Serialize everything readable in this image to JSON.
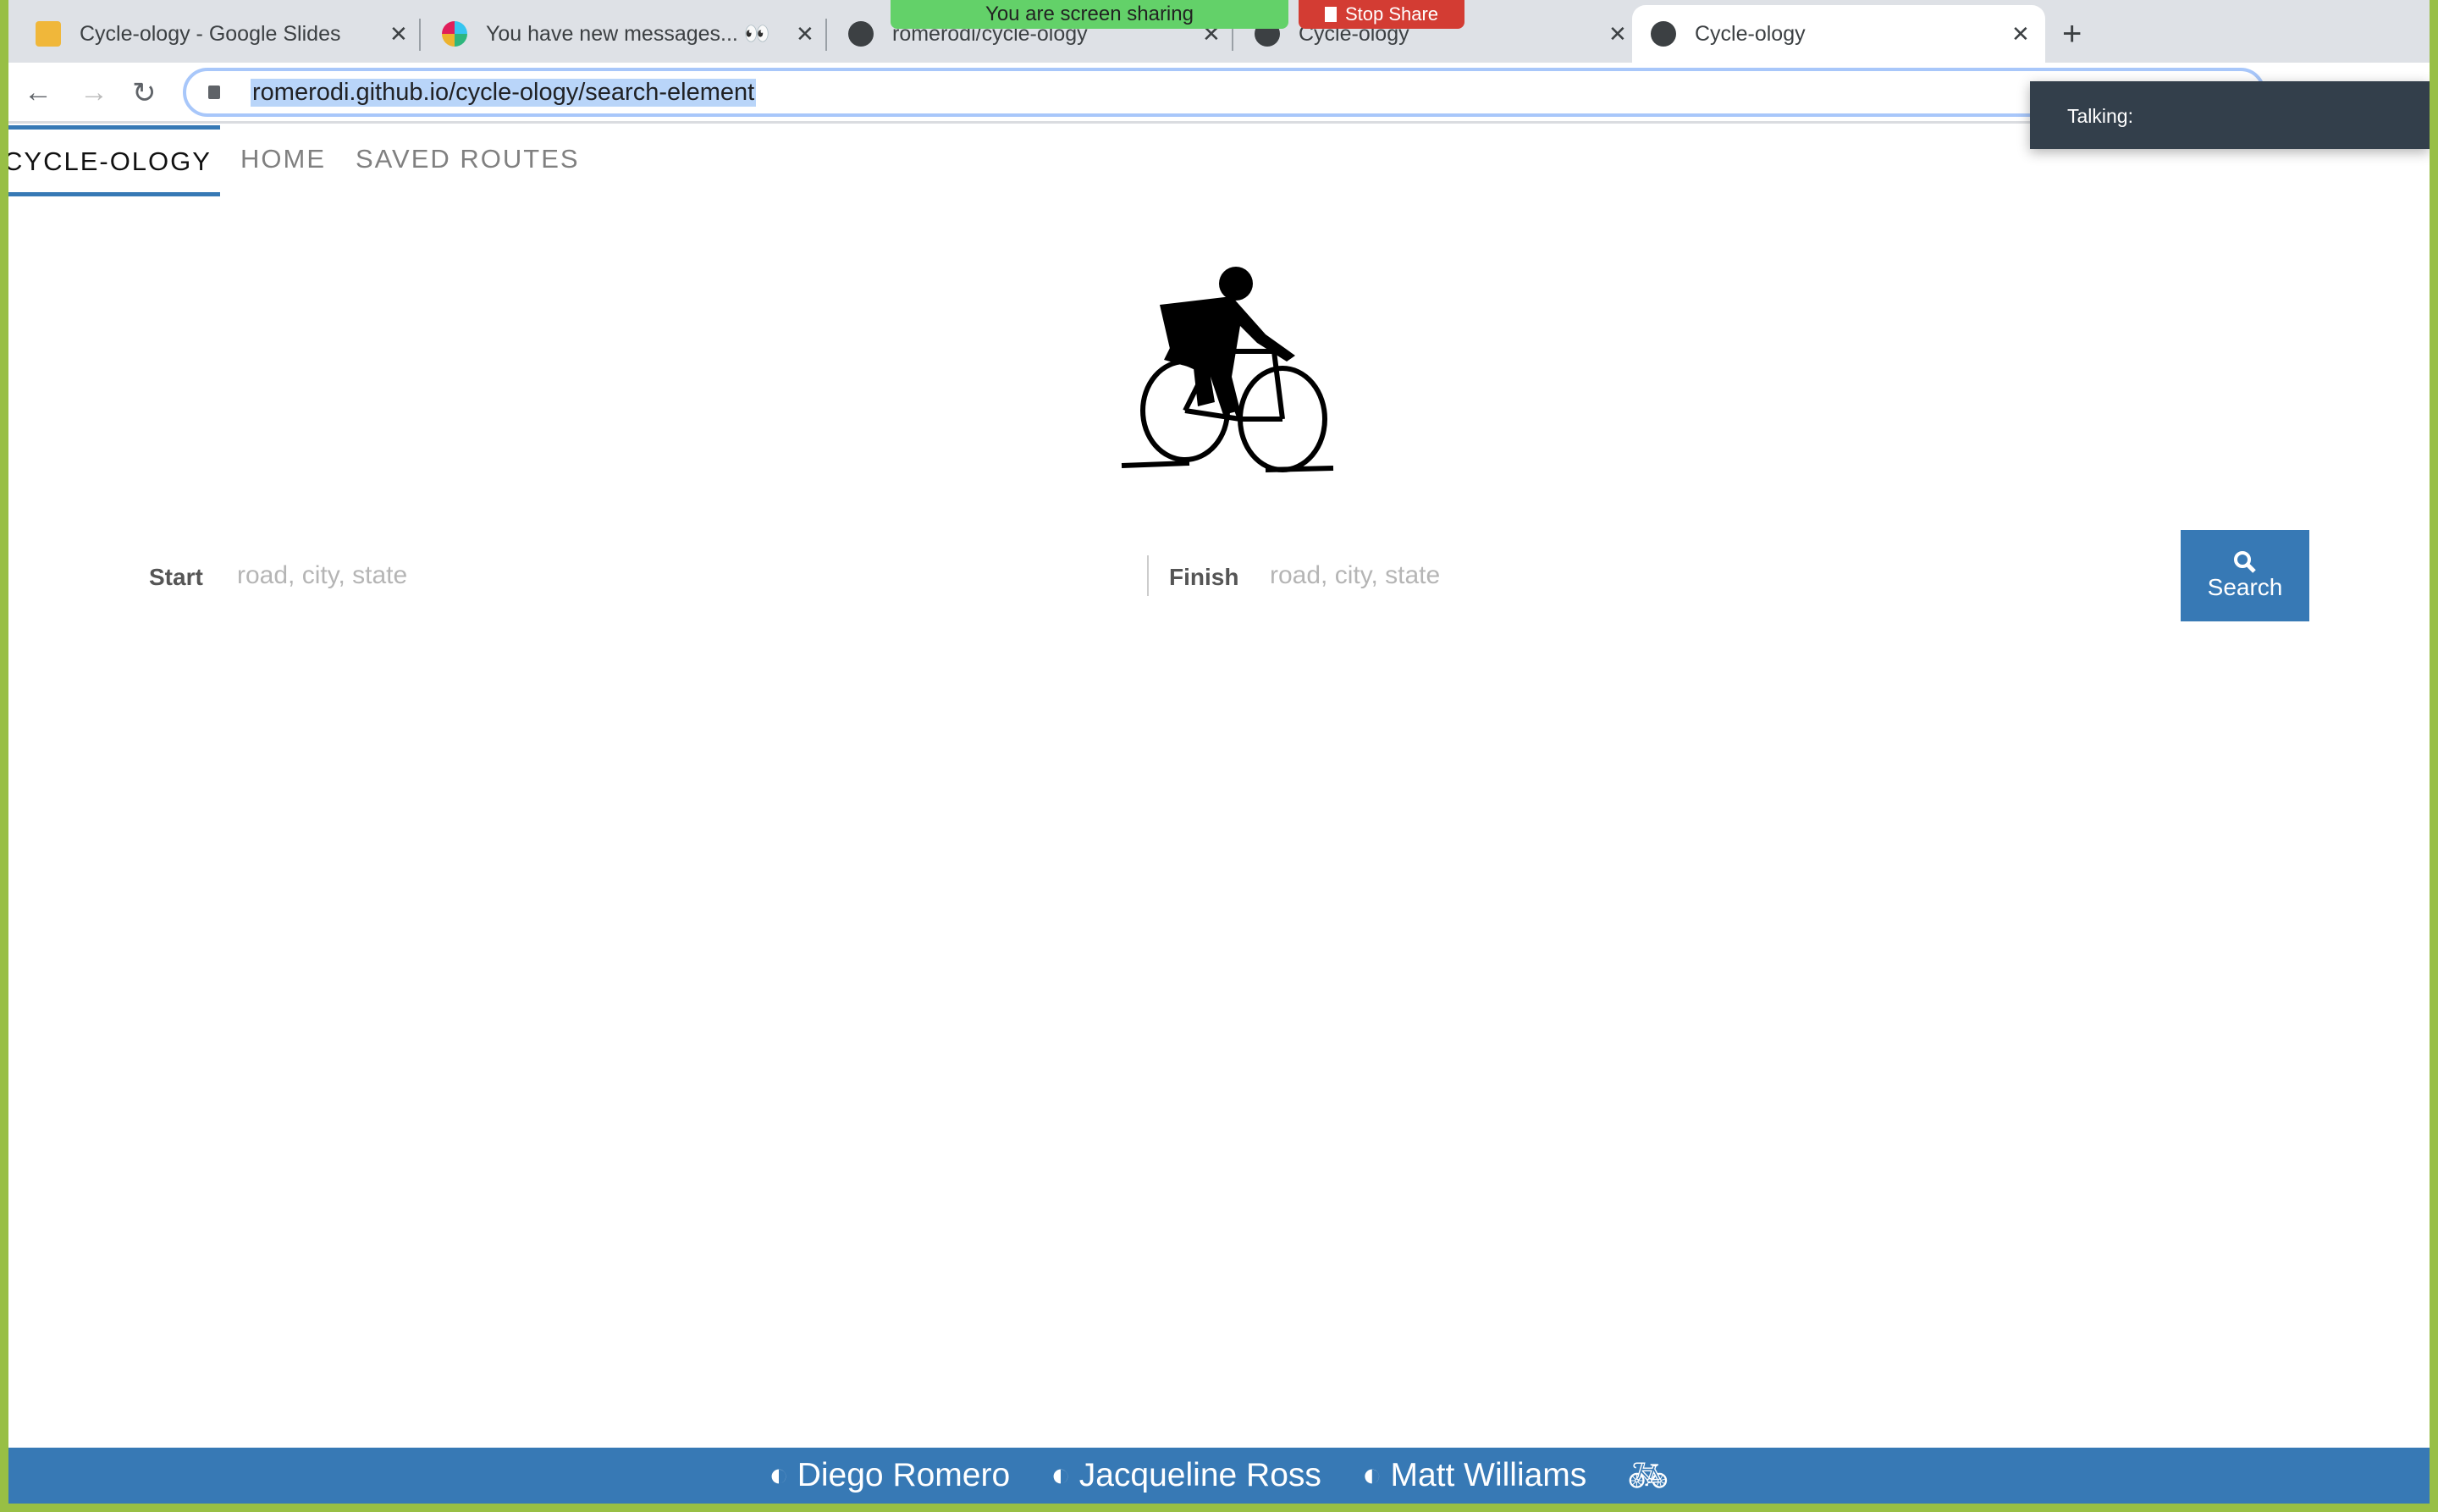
{
  "browser": {
    "tabs": [
      {
        "title": "Cycle-ology - Google Slides",
        "icon": "slides-icon"
      },
      {
        "title": "You have new messages... 👀",
        "icon": "slack-icon"
      },
      {
        "title": "romerodi/cycle-ology",
        "icon": "github-icon"
      },
      {
        "title": "Cycle-ology",
        "icon": "globe-icon"
      },
      {
        "title": "Cycle-ology",
        "icon": "globe-icon",
        "active": true
      }
    ],
    "close_glyph": "✕",
    "new_tab_glyph": "+",
    "url": "romerodi.github.io/cycle-ology/search-element"
  },
  "screen_share": {
    "text": "You are screen sharing",
    "stop_label": "Stop Share"
  },
  "talking": {
    "label": "Talking:"
  },
  "nav": {
    "brand": "CYCLE-OLOGY",
    "home": "HOME",
    "saved": "SAVED ROUTES"
  },
  "search": {
    "start_label": "Start",
    "start_placeholder": "road, city, state",
    "finish_label": "Finish",
    "finish_placeholder": "road, city, state",
    "button": "Search"
  },
  "footer": {
    "links": [
      "Diego Romero",
      "Jacqueline Ross",
      "Matt Williams"
    ]
  },
  "colors": {
    "primary": "#3779b5",
    "frame": "#98bf45"
  }
}
